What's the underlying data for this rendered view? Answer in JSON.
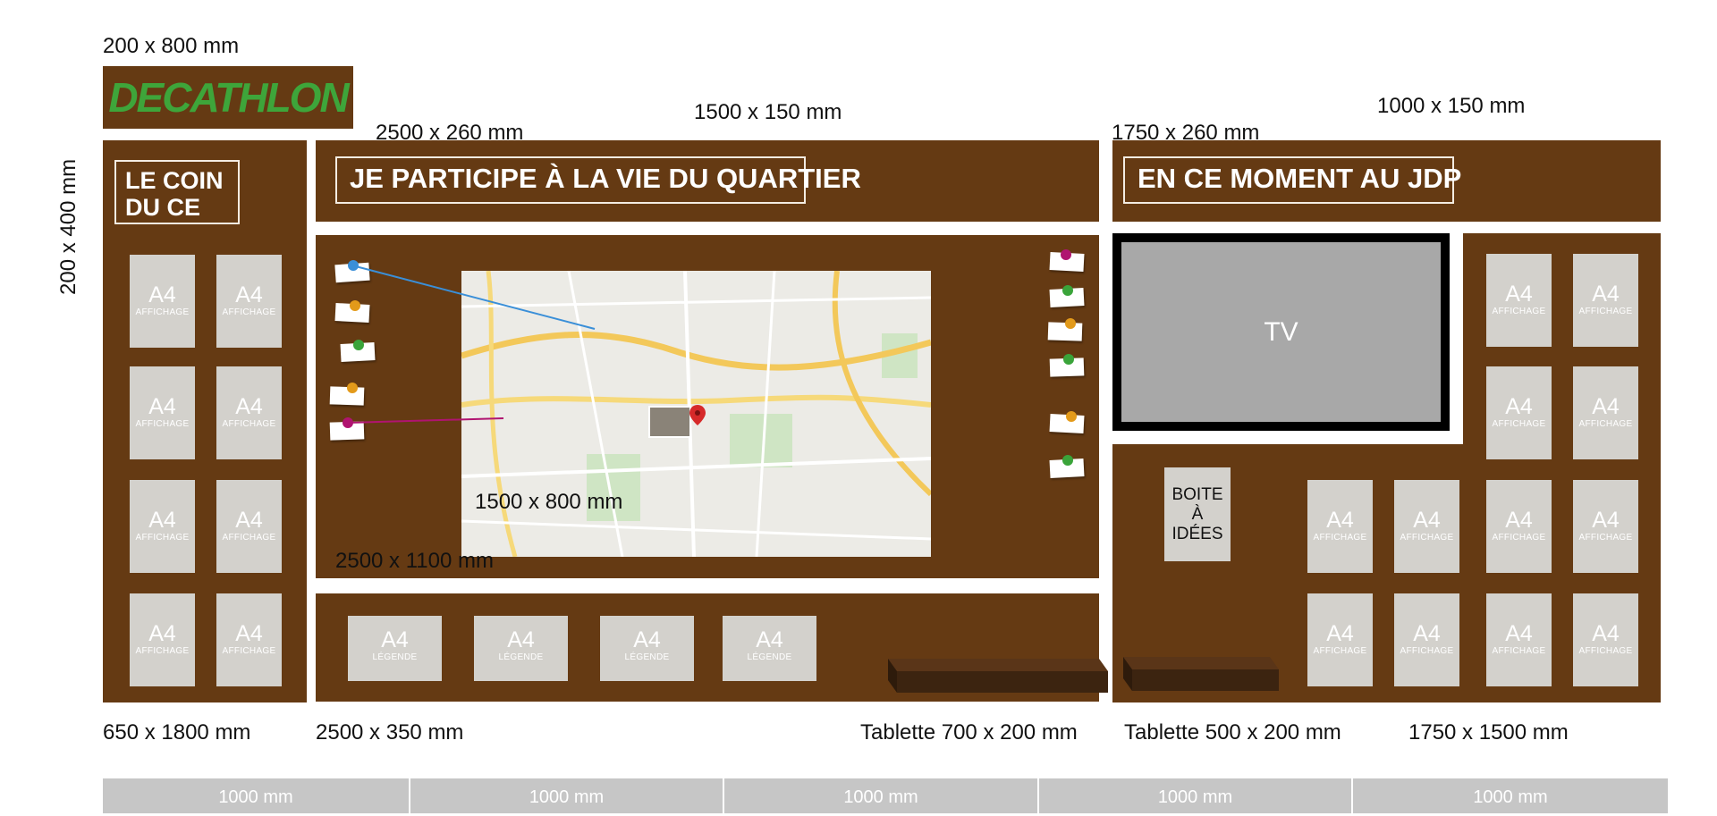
{
  "logo": {
    "text": "DECATHLON",
    "bg": "#653a13",
    "color": "#3ea53a"
  },
  "colors": {
    "panel": "#653a13",
    "a4": "#d3d1cc",
    "tv_screen": "#a8a8a8",
    "ruler": "#c6c6c6",
    "shelf": "#4a2a10"
  },
  "dimensions": {
    "logo": "200 x 800 mm",
    "coin_ce_header": "200 x 400 mm",
    "quartier_header": "2500 x 260 mm",
    "quartier_banner": "1500 x 150 mm",
    "jdp_header": "1750 x 260 mm",
    "jdp_banner": "1000 x 150 mm",
    "map": "1500 x 800 mm",
    "corkboard": "2500 x 1100 mm",
    "coin_ce_panel": "650 x 1800 mm",
    "legend_strip": "2500 x 350 mm",
    "shelf_left": "Tablette 700 x 200 mm",
    "shelf_right": "Tablette 500 x 200 mm",
    "jdp_panel": "1750 x 1500 mm"
  },
  "titles": {
    "coin_ce": [
      "LE COIN",
      "DU CE"
    ],
    "quartier": "JE PARTICIPE À LA VIE DU QUARTIER",
    "jdp": "EN CE MOMENT AU JDP"
  },
  "a4": {
    "big": "A4",
    "affichage": "AFFICHAGE",
    "legende": "LÉGENDE"
  },
  "tv": {
    "label": "TV"
  },
  "idea_box": {
    "lines": [
      "BOITE",
      "À",
      "IDÉES"
    ]
  },
  "pins": {
    "blue": "#3a8fd8",
    "orange": "#e39a1a",
    "green": "#3aa43a",
    "magenta": "#b01470"
  },
  "ruler": [
    "1000 mm",
    "1000 mm",
    "1000 mm",
    "1000 mm",
    "1000 mm"
  ]
}
